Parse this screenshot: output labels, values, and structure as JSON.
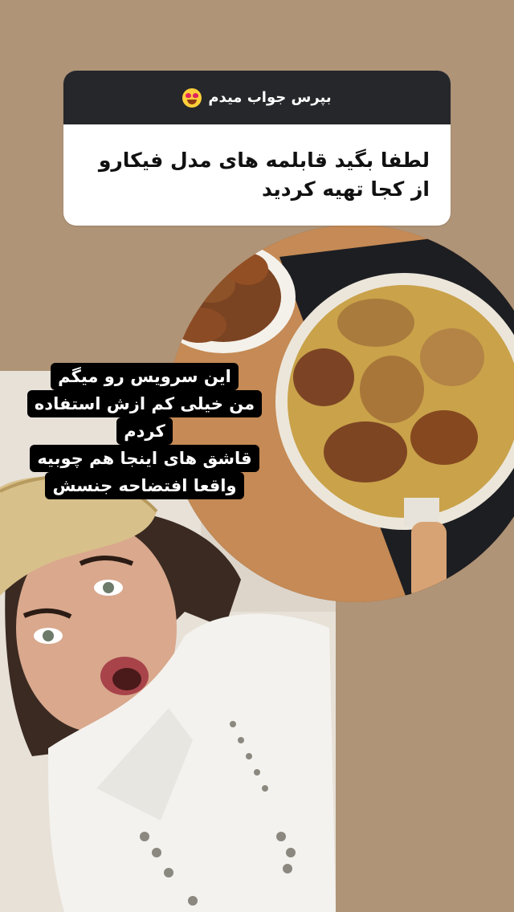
{
  "question_sticker": {
    "header": "بپرس جواب میدم",
    "header_emoji": "heart-eyes-emoji-icon",
    "question": "لطفا بگید قابلمه های مدل فیکارو از کجا تهیه کردید"
  },
  "food_photo": {
    "shape": "circle",
    "icon": "frying-pan-photo"
  },
  "caption": {
    "lines": [
      "این سرویس رو میگم",
      "من خیلی کم ازش استفاده",
      "کردم",
      "قاشق های اینجا هم چوبیه",
      "واقعا افتضاحه جنسش"
    ]
  },
  "selfie_photo": {
    "icon": "woman-with-straw-hat-photo"
  },
  "colors": {
    "background": "#b09477",
    "sticker_header": "#25272b",
    "sticker_body": "#ffffff",
    "caption_bg": "#000000",
    "caption_text": "#ffffff"
  }
}
